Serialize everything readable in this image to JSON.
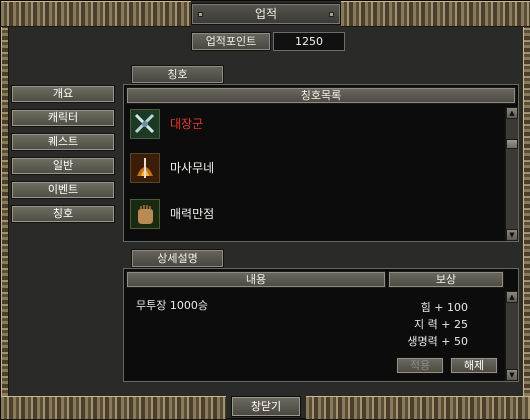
{
  "window": {
    "title": "업적"
  },
  "points": {
    "label": "업적포인트",
    "value": "1250"
  },
  "nav": {
    "items": [
      {
        "label": "개요"
      },
      {
        "label": "캐릭터"
      },
      {
        "label": "퀘스트"
      },
      {
        "label": "일반"
      },
      {
        "label": "이벤트"
      },
      {
        "label": "칭호"
      }
    ]
  },
  "title_tab": {
    "label": "칭호"
  },
  "title_list": {
    "header": "칭호목록",
    "items": [
      {
        "name": "대장군",
        "icon": "crossed-swords-icon",
        "active": true
      },
      {
        "name": "마사무네",
        "icon": "fire-sword-icon",
        "active": false
      },
      {
        "name": "매력만점",
        "icon": "hand-icon",
        "active": false
      }
    ]
  },
  "detail_tab": {
    "label": "상세설명"
  },
  "detail": {
    "col_content": "내용",
    "col_reward": "보상",
    "content": "무투장 1000승",
    "rewards": [
      "힘 + 100",
      "지  력 + 25",
      "생명력 + 50"
    ]
  },
  "buttons": {
    "apply": "적용",
    "remove": "해제",
    "close": "창닫기"
  },
  "colors": {
    "active_title": "#e23a2a",
    "background": "#2a2a28",
    "panel": "#0c0c0c"
  }
}
